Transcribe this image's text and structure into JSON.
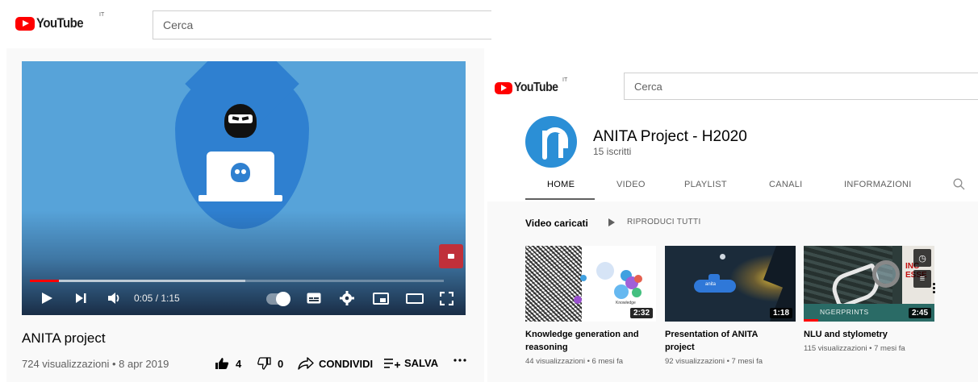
{
  "left": {
    "logo": {
      "wordmark": "YouTube",
      "country": "IT"
    },
    "search": {
      "placeholder": "Cerca"
    },
    "player": {
      "time": "0:05 / 1:15",
      "progress_played": 0.07,
      "progress_buffered": 0.52
    },
    "video": {
      "title": "ANITA project",
      "meta": "724 visualizzazioni • 8 apr 2019"
    },
    "actions": {
      "likes": "4",
      "dislikes": "0",
      "share": "CONDIVIDI",
      "save": "SALVA"
    }
  },
  "right": {
    "logo": {
      "wordmark": "YouTube",
      "country": "IT"
    },
    "search": {
      "placeholder": "Cerca"
    },
    "channel": {
      "name": "ANITA Project - H2020",
      "subscribers": "15 iscritti"
    },
    "tabs": [
      {
        "label": "HOME"
      },
      {
        "label": "VIDEO"
      },
      {
        "label": "PLAYLIST"
      },
      {
        "label": "CANALI"
      },
      {
        "label": "INFORMAZIONI"
      }
    ],
    "shelf": {
      "title": "Video caricati",
      "play_all": "RIPRODUCI TUTTI"
    },
    "videos": [
      {
        "title": "Knowledge generation and reasoning",
        "meta": "44 visualizzazioni • 6 mesi fa",
        "duration": "2:32",
        "thumb_text": "Knowledge"
      },
      {
        "title": "Presentation of ANITA project",
        "meta": "92 visualizzazioni • 7 mesi fa",
        "duration": "1:18",
        "thumb_text": "anita"
      },
      {
        "title": "NLU and stylometry",
        "meta": "115 visualizzazioni • 7 mesi fa",
        "duration": "2:45",
        "thumb_text": "NGERPRINTS",
        "paper_text": "INC ESSE"
      }
    ]
  },
  "colors": {
    "brand_red": "#ff0000",
    "anita_blue": "#2b8fd6",
    "video_bg": "#57a3d9"
  }
}
